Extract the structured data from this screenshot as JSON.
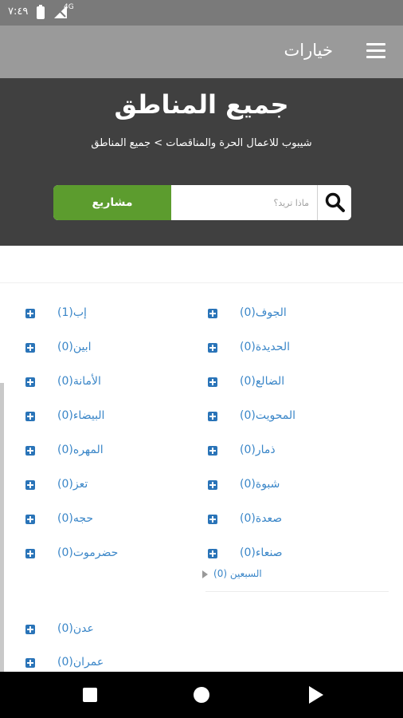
{
  "status_bar": {
    "time": "٧:٤٩",
    "network": "4G"
  },
  "app_bar": {
    "title": "خيارات"
  },
  "hero": {
    "page_title": "جميع المناطق",
    "breadcrumb": "شيبوب للاعمال الحرة والمناقصات > جميع المناطق"
  },
  "search": {
    "placeholder": "ماذا تريد؟",
    "button_label": "مشاريع"
  },
  "regions": {
    "left": [
      {
        "label": "إب(1)"
      },
      {
        "label": "ابين(0)"
      },
      {
        "label": "الأمانة(0)"
      },
      {
        "label": "البيضاء(0)"
      },
      {
        "label": "المهره(0)"
      },
      {
        "label": "تعز(0)"
      },
      {
        "label": "حجه(0)"
      },
      {
        "label": "حضرموت(0)"
      },
      {
        "label": "عدن(0)"
      },
      {
        "label": "عمران(0)"
      }
    ],
    "right": [
      {
        "label": "الجوف(0)"
      },
      {
        "label": "الحديدة(0)"
      },
      {
        "label": "الضالع(0)"
      },
      {
        "label": "المحويت(0)"
      },
      {
        "label": "ذمار(0)"
      },
      {
        "label": "شبوة(0)"
      },
      {
        "label": "صعدة(0)"
      },
      {
        "label": "صنعاء(0)"
      }
    ],
    "sub_item": "السبعين (0)"
  },
  "colors": {
    "accent_green": "#5c9c2e",
    "link_blue": "#3a86c8",
    "plus_blue": "#2a74b8",
    "hero_bg": "#404040",
    "appbar_bg": "#9a9a9a"
  },
  "icons": {
    "menu": "hamburger-icon",
    "search": "search-icon",
    "expand": "plus-icon",
    "nav_recent": "square-icon",
    "nav_home": "circle-icon",
    "nav_back": "triangle-icon"
  }
}
